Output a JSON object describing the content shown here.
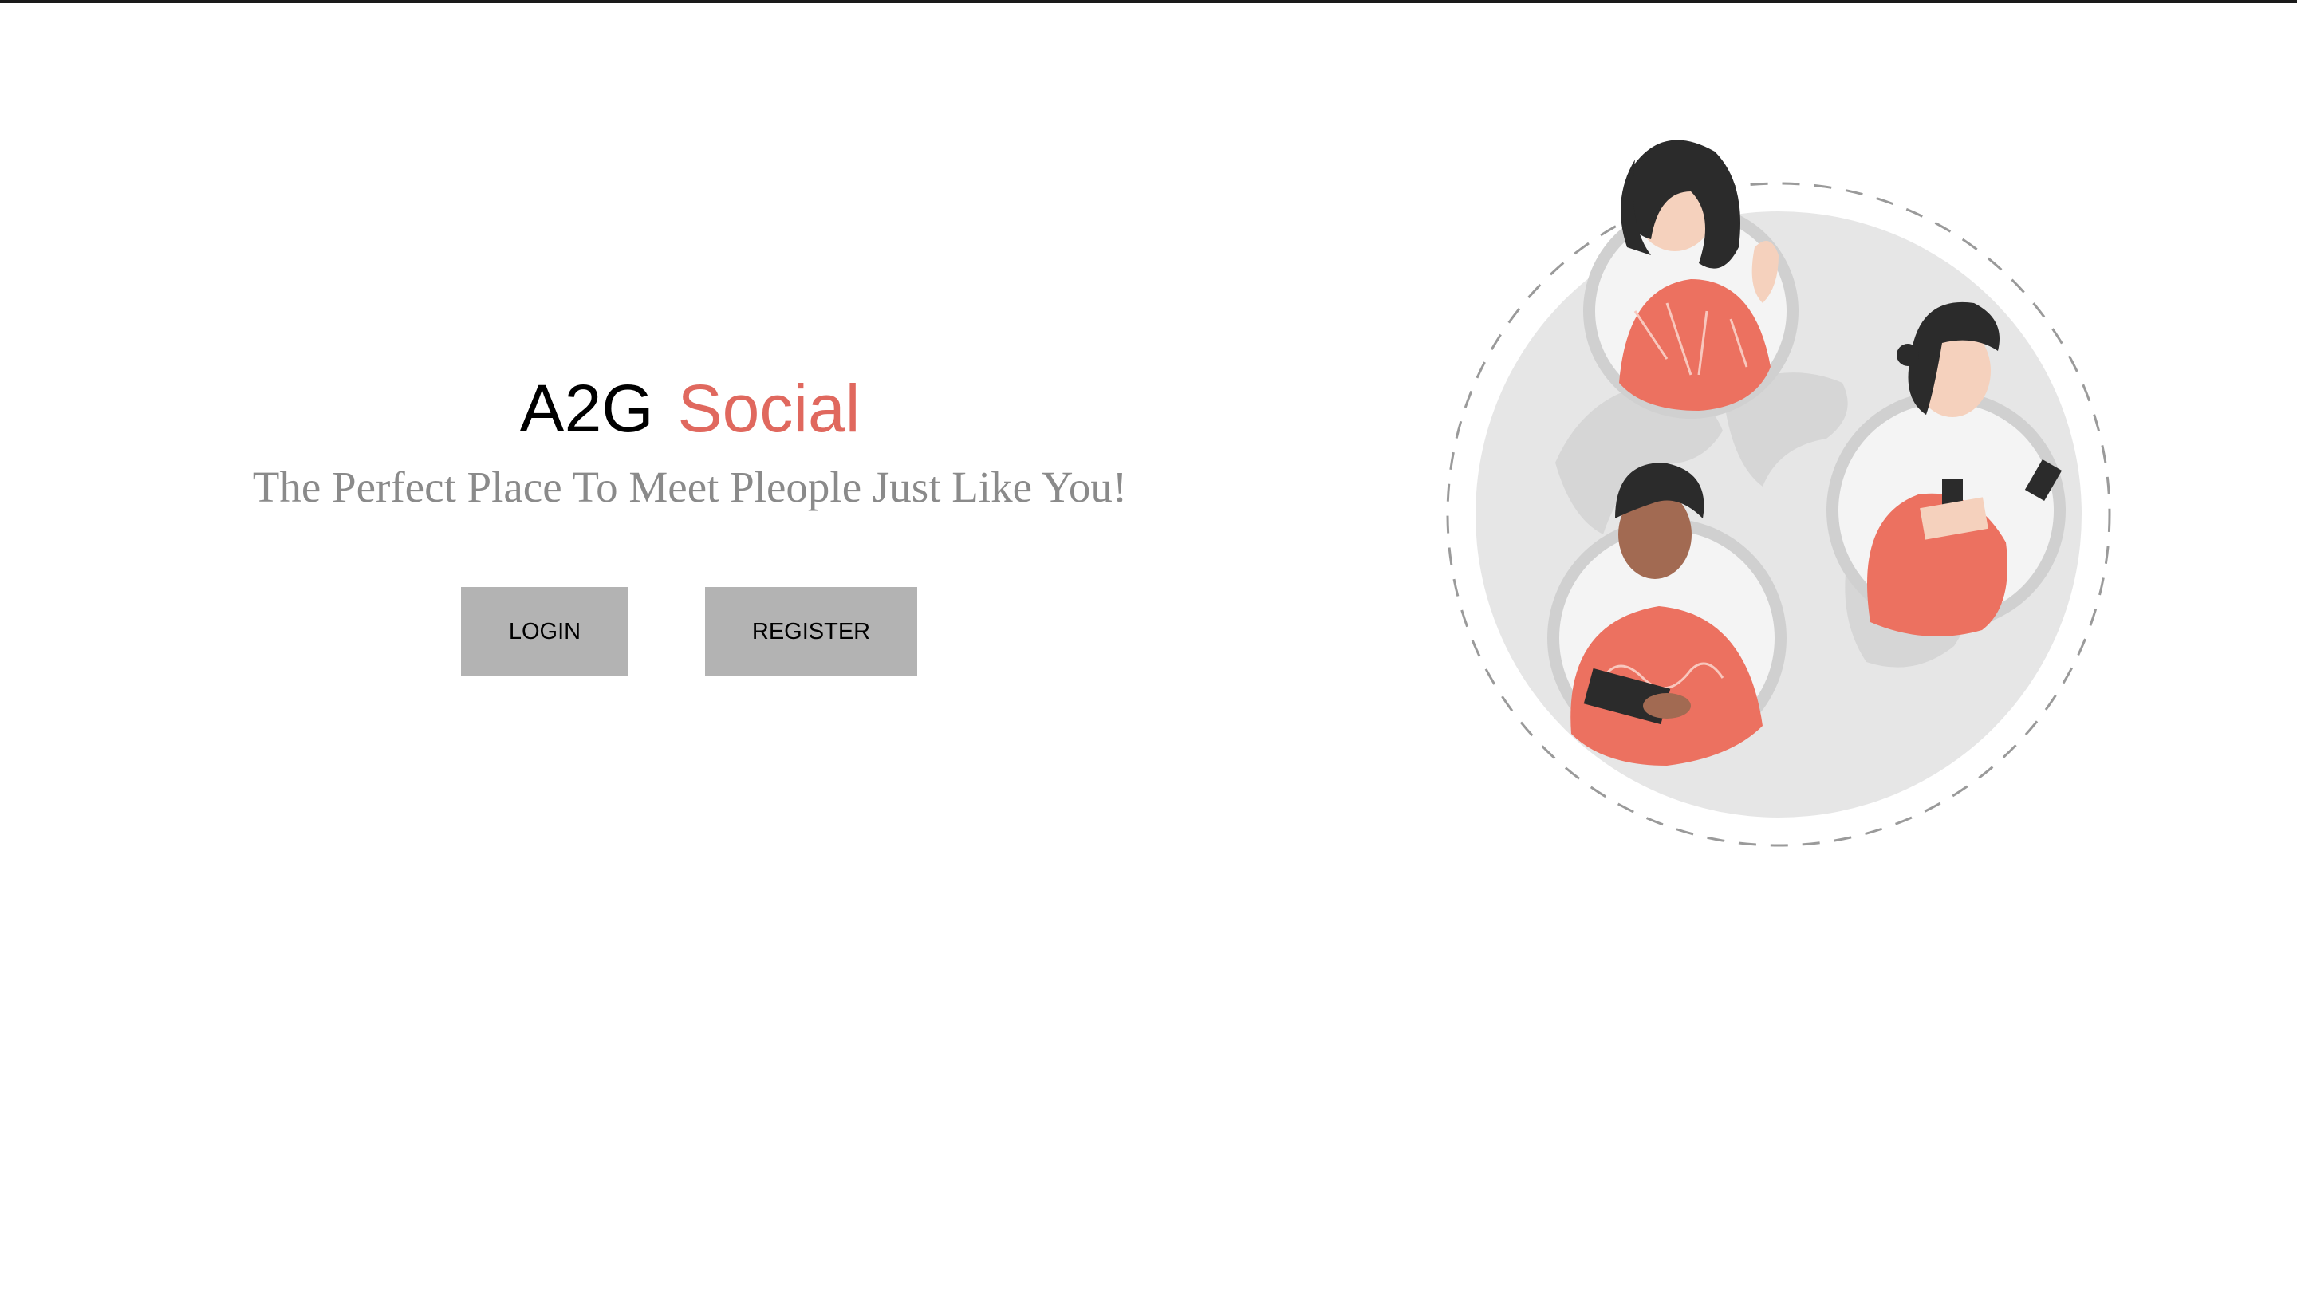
{
  "brand": {
    "name_part1": "A2G",
    "name_part2": "Social",
    "accent_color": "#e0685e"
  },
  "tagline": "The Perfect Place To Meet Pleople Just Like You!",
  "actions": {
    "login_label": "LOGIN",
    "register_label": "REGISTER"
  },
  "illustration": {
    "icon": "people-connecting-globe-illustration",
    "primary_color": "#ec7160"
  }
}
